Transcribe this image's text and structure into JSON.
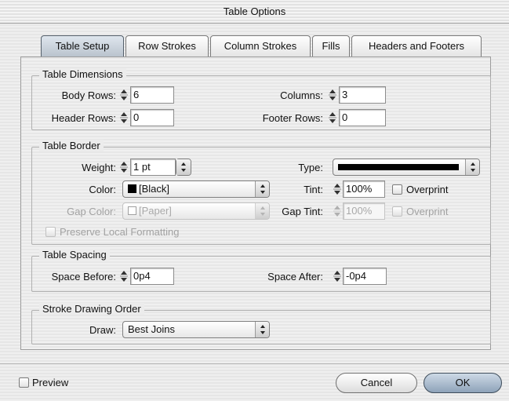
{
  "window": {
    "title": "Table Options"
  },
  "tabs": [
    {
      "label": "Table Setup",
      "active": true
    },
    {
      "label": "Row Strokes"
    },
    {
      "label": "Column Strokes"
    },
    {
      "label": "Fills"
    },
    {
      "label": "Headers and Footers"
    }
  ],
  "table_dimensions": {
    "legend": "Table Dimensions",
    "body_rows_label": "Body Rows:",
    "body_rows_value": "6",
    "columns_label": "Columns:",
    "columns_value": "3",
    "header_rows_label": "Header Rows:",
    "header_rows_value": "0",
    "footer_rows_label": "Footer Rows:",
    "footer_rows_value": "0"
  },
  "table_border": {
    "legend": "Table Border",
    "weight_label": "Weight:",
    "weight_value": "1 pt",
    "type_label": "Type:",
    "color_label": "Color:",
    "color_value": "[Black]",
    "tint_label": "Tint:",
    "tint_value": "100%",
    "overprint_label": "Overprint",
    "gap_color_label": "Gap Color:",
    "gap_color_value": "[Paper]",
    "gap_tint_label": "Gap Tint:",
    "gap_tint_value": "100%",
    "gap_overprint_label": "Overprint",
    "preserve_label": "Preserve Local Formatting"
  },
  "table_spacing": {
    "legend": "Table Spacing",
    "space_before_label": "Space Before:",
    "space_before_value": "0p4",
    "space_after_label": "Space After:",
    "space_after_value": "-0p4"
  },
  "stroke_order": {
    "legend": "Stroke Drawing Order",
    "draw_label": "Draw:",
    "draw_value": "Best Joins"
  },
  "footer": {
    "preview_label": "Preview",
    "cancel_label": "Cancel",
    "ok_label": "OK"
  },
  "colors": {
    "black_swatch": "#000000",
    "paper_swatch": "#ffffff"
  }
}
